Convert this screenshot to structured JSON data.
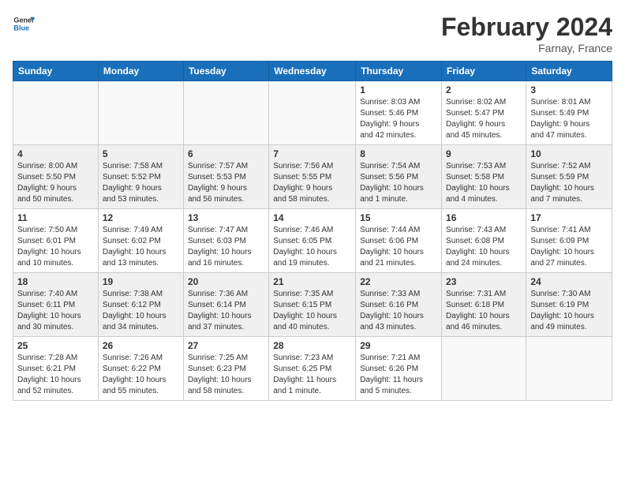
{
  "header": {
    "logo_general": "General",
    "logo_blue": "Blue",
    "month_title": "February 2024",
    "location": "Farnay, France"
  },
  "weekdays": [
    "Sunday",
    "Monday",
    "Tuesday",
    "Wednesday",
    "Thursday",
    "Friday",
    "Saturday"
  ],
  "weeks": [
    {
      "shaded": false,
      "days": [
        {
          "num": "",
          "info": ""
        },
        {
          "num": "",
          "info": ""
        },
        {
          "num": "",
          "info": ""
        },
        {
          "num": "",
          "info": ""
        },
        {
          "num": "1",
          "info": "Sunrise: 8:03 AM\nSunset: 5:46 PM\nDaylight: 9 hours\nand 42 minutes."
        },
        {
          "num": "2",
          "info": "Sunrise: 8:02 AM\nSunset: 5:47 PM\nDaylight: 9 hours\nand 45 minutes."
        },
        {
          "num": "3",
          "info": "Sunrise: 8:01 AM\nSunset: 5:49 PM\nDaylight: 9 hours\nand 47 minutes."
        }
      ]
    },
    {
      "shaded": true,
      "days": [
        {
          "num": "4",
          "info": "Sunrise: 8:00 AM\nSunset: 5:50 PM\nDaylight: 9 hours\nand 50 minutes."
        },
        {
          "num": "5",
          "info": "Sunrise: 7:58 AM\nSunset: 5:52 PM\nDaylight: 9 hours\nand 53 minutes."
        },
        {
          "num": "6",
          "info": "Sunrise: 7:57 AM\nSunset: 5:53 PM\nDaylight: 9 hours\nand 56 minutes."
        },
        {
          "num": "7",
          "info": "Sunrise: 7:56 AM\nSunset: 5:55 PM\nDaylight: 9 hours\nand 58 minutes."
        },
        {
          "num": "8",
          "info": "Sunrise: 7:54 AM\nSunset: 5:56 PM\nDaylight: 10 hours\nand 1 minute."
        },
        {
          "num": "9",
          "info": "Sunrise: 7:53 AM\nSunset: 5:58 PM\nDaylight: 10 hours\nand 4 minutes."
        },
        {
          "num": "10",
          "info": "Sunrise: 7:52 AM\nSunset: 5:59 PM\nDaylight: 10 hours\nand 7 minutes."
        }
      ]
    },
    {
      "shaded": false,
      "days": [
        {
          "num": "11",
          "info": "Sunrise: 7:50 AM\nSunset: 6:01 PM\nDaylight: 10 hours\nand 10 minutes."
        },
        {
          "num": "12",
          "info": "Sunrise: 7:49 AM\nSunset: 6:02 PM\nDaylight: 10 hours\nand 13 minutes."
        },
        {
          "num": "13",
          "info": "Sunrise: 7:47 AM\nSunset: 6:03 PM\nDaylight: 10 hours\nand 16 minutes."
        },
        {
          "num": "14",
          "info": "Sunrise: 7:46 AM\nSunset: 6:05 PM\nDaylight: 10 hours\nand 19 minutes."
        },
        {
          "num": "15",
          "info": "Sunrise: 7:44 AM\nSunset: 6:06 PM\nDaylight: 10 hours\nand 21 minutes."
        },
        {
          "num": "16",
          "info": "Sunrise: 7:43 AM\nSunset: 6:08 PM\nDaylight: 10 hours\nand 24 minutes."
        },
        {
          "num": "17",
          "info": "Sunrise: 7:41 AM\nSunset: 6:09 PM\nDaylight: 10 hours\nand 27 minutes."
        }
      ]
    },
    {
      "shaded": true,
      "days": [
        {
          "num": "18",
          "info": "Sunrise: 7:40 AM\nSunset: 6:11 PM\nDaylight: 10 hours\nand 30 minutes."
        },
        {
          "num": "19",
          "info": "Sunrise: 7:38 AM\nSunset: 6:12 PM\nDaylight: 10 hours\nand 34 minutes."
        },
        {
          "num": "20",
          "info": "Sunrise: 7:36 AM\nSunset: 6:14 PM\nDaylight: 10 hours\nand 37 minutes."
        },
        {
          "num": "21",
          "info": "Sunrise: 7:35 AM\nSunset: 6:15 PM\nDaylight: 10 hours\nand 40 minutes."
        },
        {
          "num": "22",
          "info": "Sunrise: 7:33 AM\nSunset: 6:16 PM\nDaylight: 10 hours\nand 43 minutes."
        },
        {
          "num": "23",
          "info": "Sunrise: 7:31 AM\nSunset: 6:18 PM\nDaylight: 10 hours\nand 46 minutes."
        },
        {
          "num": "24",
          "info": "Sunrise: 7:30 AM\nSunset: 6:19 PM\nDaylight: 10 hours\nand 49 minutes."
        }
      ]
    },
    {
      "shaded": false,
      "days": [
        {
          "num": "25",
          "info": "Sunrise: 7:28 AM\nSunset: 6:21 PM\nDaylight: 10 hours\nand 52 minutes."
        },
        {
          "num": "26",
          "info": "Sunrise: 7:26 AM\nSunset: 6:22 PM\nDaylight: 10 hours\nand 55 minutes."
        },
        {
          "num": "27",
          "info": "Sunrise: 7:25 AM\nSunset: 6:23 PM\nDaylight: 10 hours\nand 58 minutes."
        },
        {
          "num": "28",
          "info": "Sunrise: 7:23 AM\nSunset: 6:25 PM\nDaylight: 11 hours\nand 1 minute."
        },
        {
          "num": "29",
          "info": "Sunrise: 7:21 AM\nSunset: 6:26 PM\nDaylight: 11 hours\nand 5 minutes."
        },
        {
          "num": "",
          "info": ""
        },
        {
          "num": "",
          "info": ""
        }
      ]
    }
  ]
}
